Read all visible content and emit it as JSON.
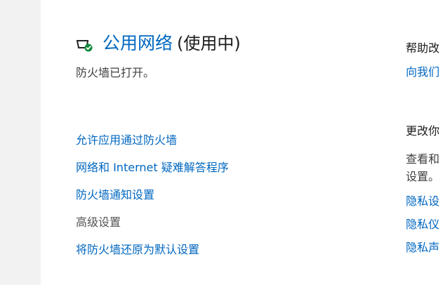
{
  "network": {
    "icon": "network-shield-check-icon",
    "name": "公用网络",
    "status": "(使用中)",
    "firewall_state": "防火墙已打开。"
  },
  "links": {
    "allow_app": "允许应用通过防火墙",
    "troubleshooter": "网络和 Internet 疑难解答程序",
    "notifications": "防火墙通知设置",
    "advanced": "高级设置",
    "restore_defaults": "将防火墙还原为默认设置"
  },
  "right_panel": {
    "help_heading": "帮助改",
    "help_link": "向我们",
    "privacy_heading": "更改你",
    "privacy_text_line1": "查看和",
    "privacy_text_line2": "设置。",
    "privacy_link_1": "隐私设",
    "privacy_link_2": "隐私仪",
    "privacy_link_3": "隐私声"
  },
  "colors": {
    "accent": "#0067c0",
    "rail": "#f2f2f2",
    "check": "#0f8a3a"
  }
}
